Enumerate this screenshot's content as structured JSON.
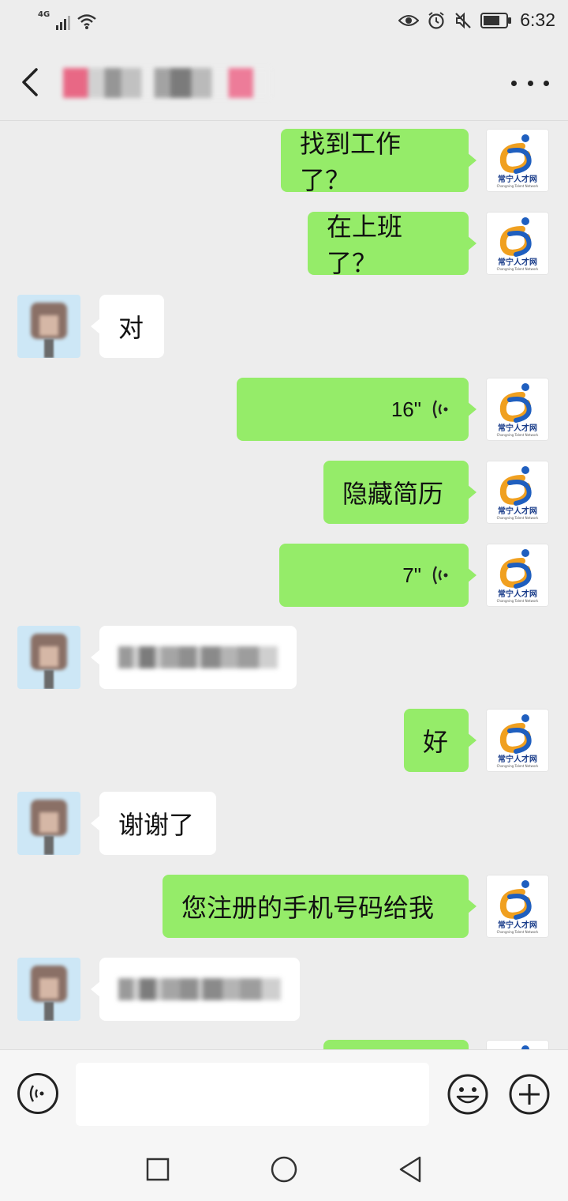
{
  "status_bar": {
    "network": "4G",
    "time": "6:32",
    "icons": [
      "signal-icon",
      "wifi-icon",
      "eye-icon",
      "alarm-icon",
      "mute-icon",
      "battery-icon"
    ]
  },
  "header": {
    "title": "",
    "back_icon": "chevron-left-icon",
    "more_icon": "more-dots-icon"
  },
  "contact_logo": {
    "name": "常宁人才网",
    "subtitle": "Changning Talent Network",
    "colors": {
      "blue": "#1f5fbf",
      "orange": "#f0a020",
      "text": "#1a3d8a"
    }
  },
  "messages": [
    {
      "from": "self",
      "type": "text",
      "text": "找到工作了？"
    },
    {
      "from": "self",
      "type": "text",
      "text": "在上班了？"
    },
    {
      "from": "other",
      "type": "text",
      "text": "对"
    },
    {
      "from": "self",
      "type": "voice",
      "duration": "16\""
    },
    {
      "from": "self",
      "type": "text",
      "text": "隐藏简历"
    },
    {
      "from": "self",
      "type": "voice",
      "duration": "7\""
    },
    {
      "from": "other",
      "type": "text",
      "text": "",
      "blurred": true
    },
    {
      "from": "self",
      "type": "text",
      "text": "好"
    },
    {
      "from": "other",
      "type": "text",
      "text": "谢谢了"
    },
    {
      "from": "self",
      "type": "text",
      "text": "您注册的手机号码给我"
    },
    {
      "from": "other",
      "type": "text",
      "text": "",
      "blurred": true
    },
    {
      "from": "self",
      "type": "text",
      "text": "",
      "partial": true
    }
  ],
  "input_bar": {
    "value": "",
    "placeholder": "",
    "voice_icon": "voice-icon",
    "emoji_icon": "emoji-icon",
    "plus_icon": "plus-circle-icon"
  },
  "android_nav": {
    "icons": [
      "recent-apps-icon",
      "home-icon",
      "back-triangle-icon"
    ]
  },
  "colors": {
    "background": "#ededed",
    "self_bubble": "#95ec69",
    "other_bubble": "#ffffff"
  }
}
